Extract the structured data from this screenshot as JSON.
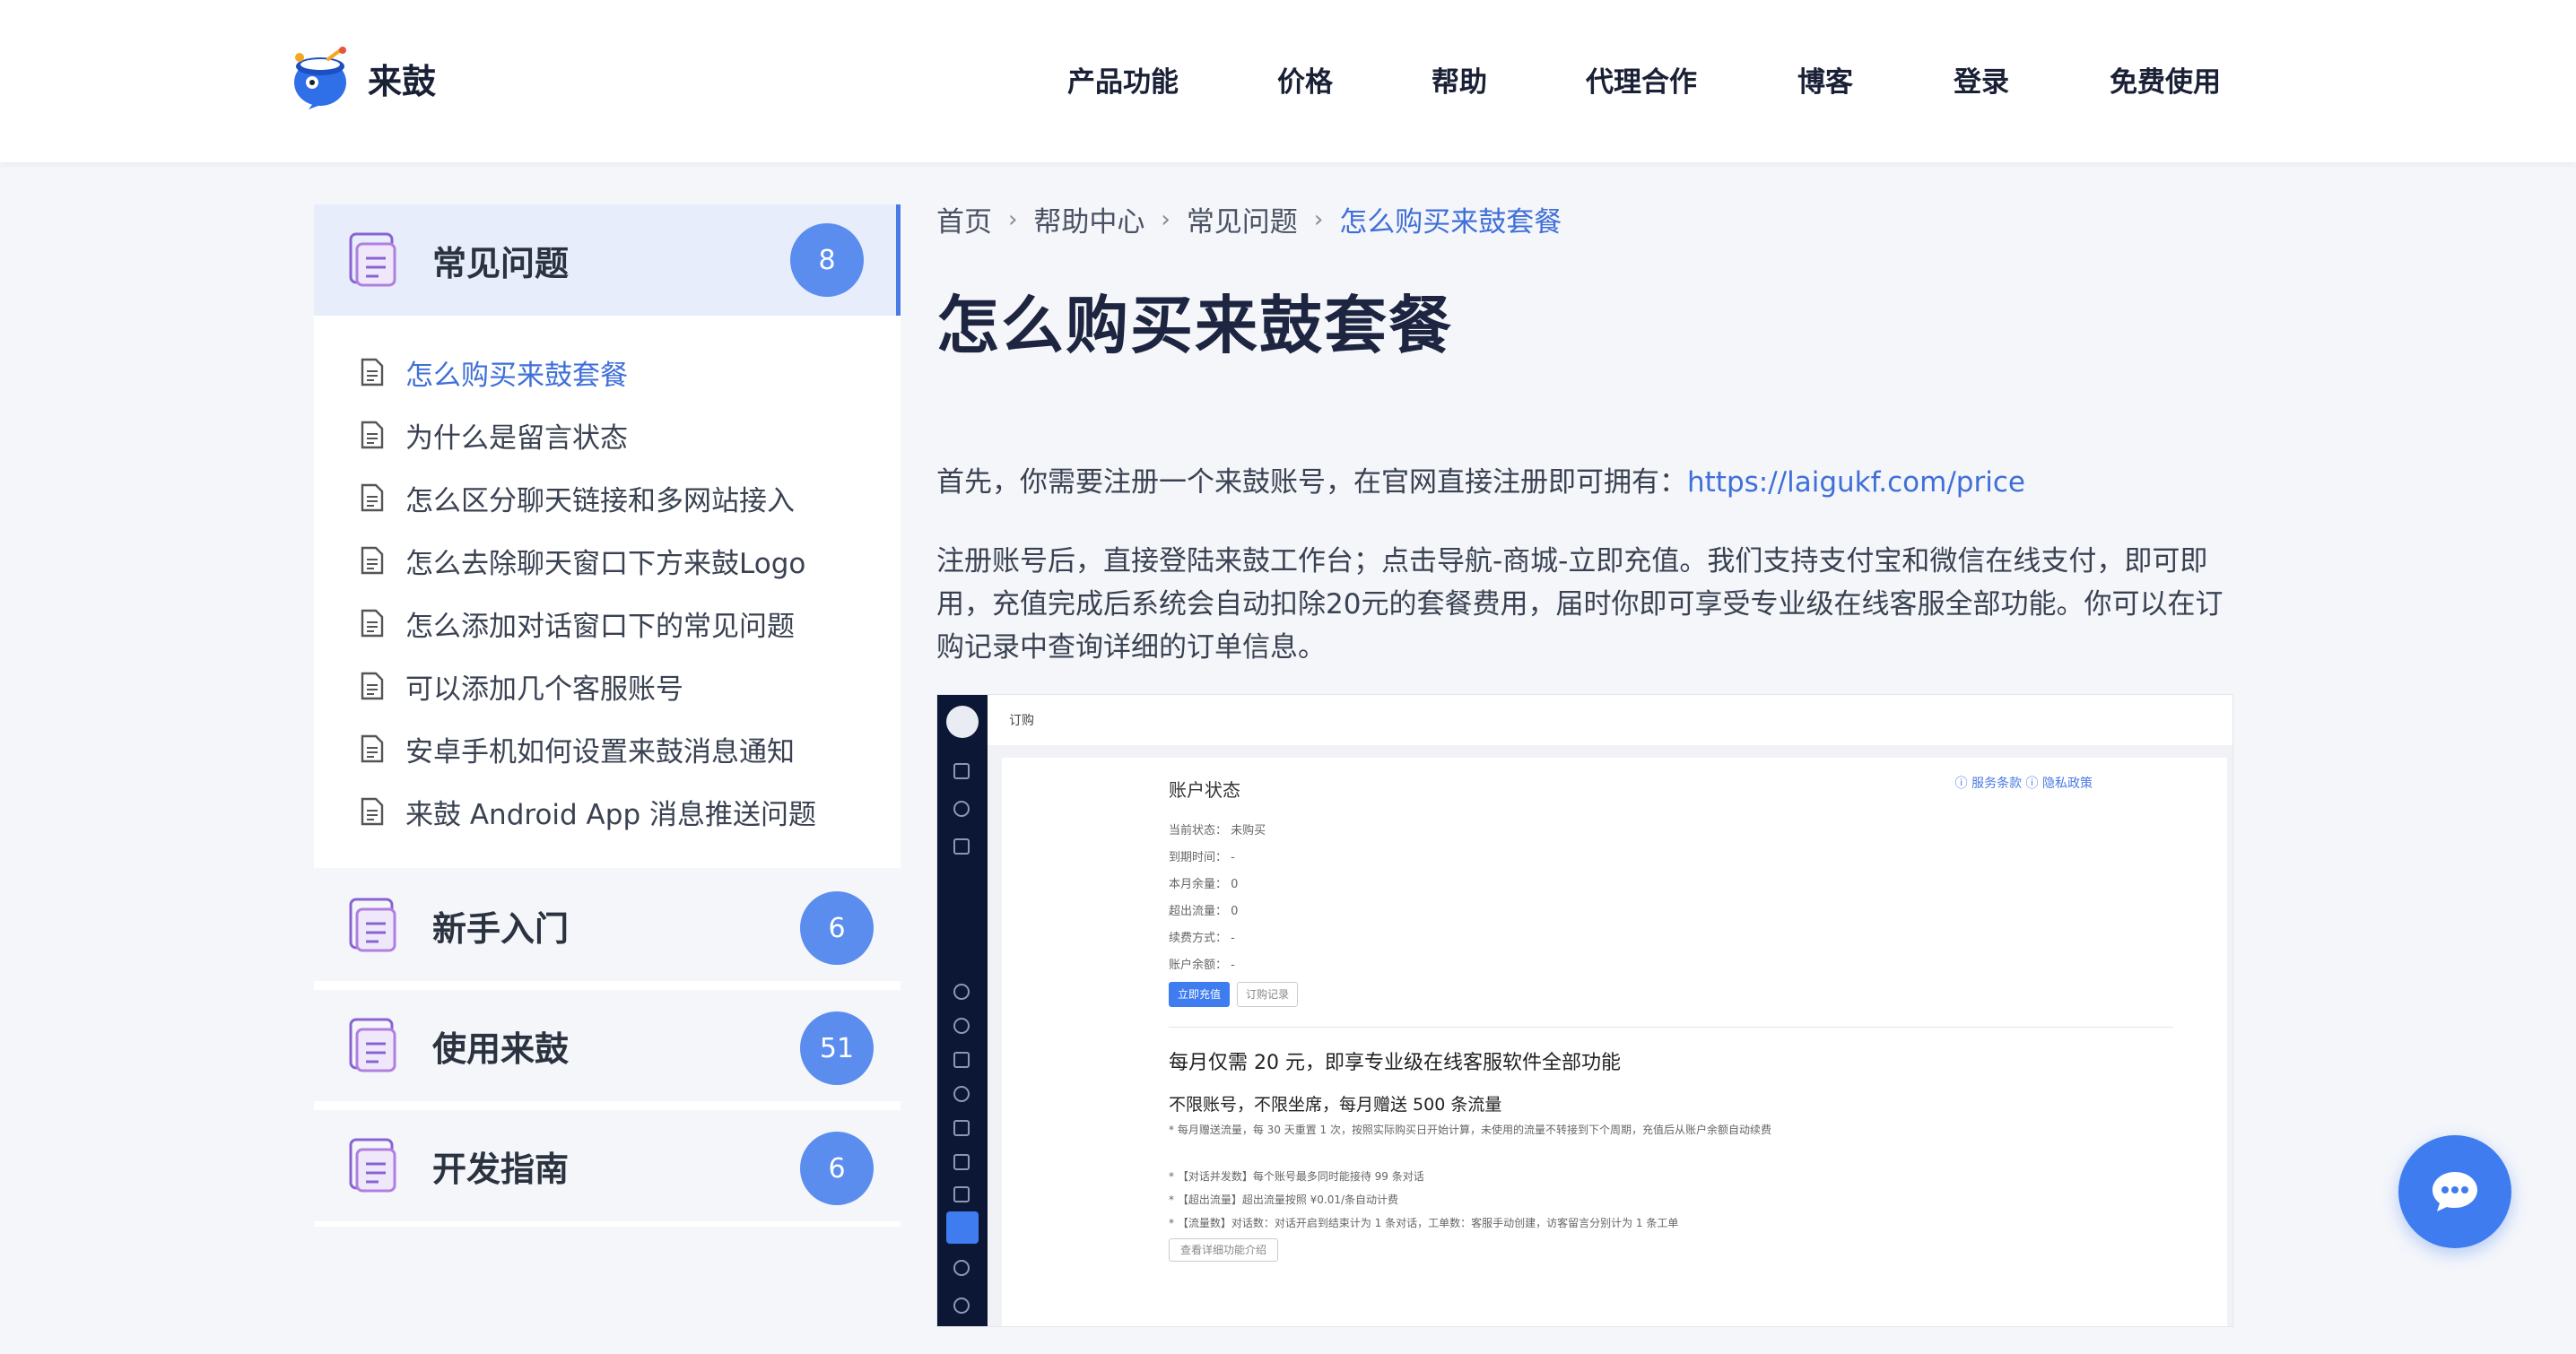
{
  "header": {
    "brand": "来鼓",
    "nav": [
      "产品功能",
      "价格",
      "帮助",
      "代理合作",
      "博客",
      "登录",
      "免费使用"
    ]
  },
  "sidebar": {
    "categories": [
      {
        "title": "常见问题",
        "count": "8",
        "expanded": true,
        "items": [
          "怎么购买来鼓套餐",
          "为什么是留言状态",
          "怎么区分聊天链接和多网站接入",
          "怎么去除聊天窗口下方来鼓Logo",
          "怎么添加对话窗口下的常见问题",
          "可以添加几个客服账号",
          "安卓手机如何设置来鼓消息通知",
          "来鼓 Android App 消息推送问题"
        ]
      },
      {
        "title": "新手入门",
        "count": "6"
      },
      {
        "title": "使用来鼓",
        "count": "51"
      },
      {
        "title": "开发指南",
        "count": "6"
      }
    ]
  },
  "breadcrumb": [
    "首页",
    "帮助中心",
    "常见问题",
    "怎么购买来鼓套餐"
  ],
  "article": {
    "title": "怎么购买来鼓套餐",
    "para1_text": "首先，你需要注册一个来鼓账号，在官网直接注册即可拥有：",
    "para1_link": "https://laigukf.com/price",
    "para2": "注册账号后，直接登陆来鼓工作台；点击导航-商城-立即充值。我们支持支付宝和微信在线支付，即可即用，充值完成后系统会自动扣除20元的套餐费用，届时你即可享受专业级在线客服全部功能。你可以在订购记录中查询详细的订单信息。"
  },
  "screenshot": {
    "topbar": "订购",
    "card_title": "账户状态",
    "links": "ⓘ 服务条款  ⓘ 隐私政策",
    "rows": [
      "当前状态：  未购买",
      "到期时间：  -",
      "本月余量：  0",
      "超出流量：  0",
      "续费方式：  -",
      "账户余额：  -"
    ],
    "btn_primary": "立即充值",
    "btn_secondary": "订购记录",
    "headline": "每月仅需 20 元，即享专业级在线客服软件全部功能",
    "subline": "不限账号，不限坐席，每月赠送 500 条流量",
    "notes": [
      "* 每月赠送流量，每 30 天重置 1 次，按照实际购买日开始计算，未使用的流量不转接到下个周期，充值后从账户余额自动续费",
      "* 【对话并发数】每个账号最多同时能接待 99 条对话",
      "* 【超出流量】超出流量按照 ¥0.01/条自动计费",
      "* 【流量数】对话数：对话开启到结束计为 1 条对话，工单数：客服手动创建，访客留言分别计为 1 条工单"
    ],
    "more_btn": "查看详细功能介绍"
  },
  "colors": {
    "accent": "#3f6fd8",
    "badge": "#5b8def",
    "chat": "#3f7cf0"
  }
}
